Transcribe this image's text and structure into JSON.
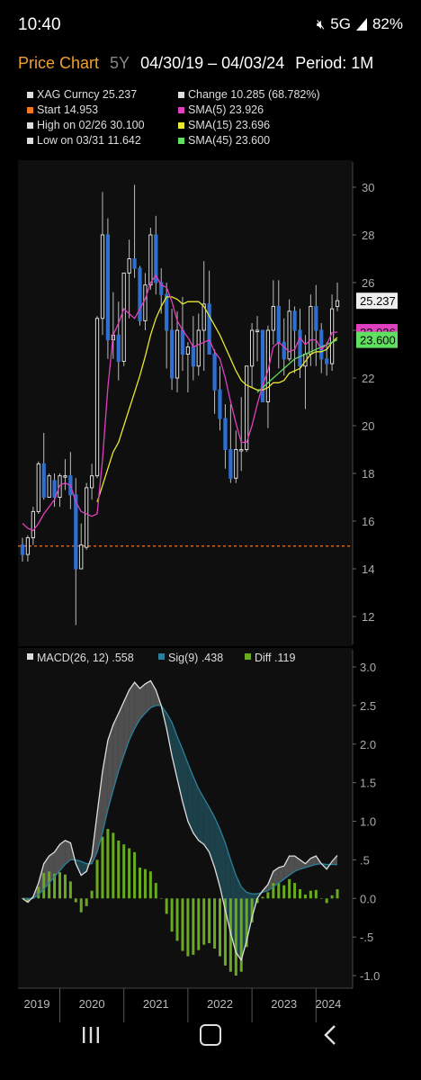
{
  "status_bar": {
    "time": "10:40",
    "network": "5G",
    "battery": "82%"
  },
  "header": {
    "title": "Price Chart",
    "range": "5Y",
    "dates": "04/30/19 – 04/03/24",
    "period": "Period: 1M"
  },
  "legend": [
    {
      "text": "XAG Curncy 25.237",
      "color": "#dddddd"
    },
    {
      "text": "Change 10.285 (68.782%)",
      "color": "#dddddd"
    },
    {
      "text": "Start 14.953",
      "color": "#f07820"
    },
    {
      "text": "SMA(5) 23.926",
      "color": "#e040c0"
    },
    {
      "text": "High on 02/26 30.100",
      "color": "#dddddd"
    },
    {
      "text": "SMA(15) 23.696",
      "color": "#e8e830"
    },
    {
      "text": "Low on 03/31 11.642",
      "color": "#dddddd"
    },
    {
      "text": "SMA(45) 23.600",
      "color": "#60e060"
    }
  ],
  "price_panel": {
    "y_ticks": [
      "30",
      "28",
      "26",
      "24",
      "22",
      "20",
      "18",
      "16",
      "14",
      "12"
    ],
    "last_price_label": "25.237",
    "sma5_label": "23.926",
    "sma45_label": "23.600"
  },
  "macd_panel": {
    "legend": [
      {
        "text": "MACD(26, 12) .558",
        "color": "#dddddd"
      },
      {
        "text": "Sig(9) .438",
        "color": "#2a7f9a"
      },
      {
        "text": "Diff .119",
        "color": "#6aaa20"
      }
    ],
    "y_ticks": [
      "3.0",
      "2.5",
      "2.0",
      "1.5",
      "1.0",
      ".5",
      "0.0",
      "-.5",
      "-1.0"
    ]
  },
  "x_axis": {
    "years": [
      "2019",
      "2020",
      "2021",
      "2022",
      "2023",
      "2024"
    ]
  },
  "colors": {
    "bull": "#dddddd",
    "bear": "#2e6fd0",
    "sma5": "#e040c0",
    "sma15": "#e8e830",
    "sma45": "#60e060",
    "start_line": "#f07820",
    "macd": "#dddddd",
    "signal": "#2a7f9a",
    "diff": "#6aaa20"
  },
  "chart_data": [
    {
      "type": "candlestick",
      "title": "XAG Curncy",
      "y_range": [
        11,
        31
      ],
      "start_value": 14.953,
      "periods": [
        "2019-05",
        "2019-06",
        "2019-07",
        "2019-08",
        "2019-09",
        "2019-10",
        "2019-11",
        "2019-12",
        "2020-01",
        "2020-02",
        "2020-03",
        "2020-04",
        "2020-05",
        "2020-06",
        "2020-07",
        "2020-08",
        "2020-09",
        "2020-10",
        "2020-11",
        "2020-12",
        "2021-01",
        "2021-02",
        "2021-03",
        "2021-04",
        "2021-05",
        "2021-06",
        "2021-07",
        "2021-08",
        "2021-09",
        "2021-10",
        "2021-11",
        "2021-12",
        "2022-01",
        "2022-02",
        "2022-03",
        "2022-04",
        "2022-05",
        "2022-06",
        "2022-07",
        "2022-08",
        "2022-09",
        "2022-10",
        "2022-11",
        "2022-12",
        "2023-01",
        "2023-02",
        "2023-03",
        "2023-04",
        "2023-05",
        "2023-06",
        "2023-07",
        "2023-08",
        "2023-09",
        "2023-10",
        "2023-11",
        "2023-12",
        "2024-01",
        "2024-02",
        "2024-03",
        "2024-04"
      ],
      "open": [
        15.0,
        14.6,
        15.3,
        16.4,
        18.4,
        17.0,
        17.7,
        17.0,
        17.9,
        17.9,
        17.1,
        14.0,
        14.9,
        17.4,
        17.9,
        24.5,
        28.0,
        23.6,
        23.8,
        22.7,
        26.4,
        27.0,
        26.6,
        24.4,
        25.9,
        28.0,
        26.0,
        25.5,
        24.0,
        22.0,
        24.0,
        23.0,
        23.3,
        22.5,
        24.0,
        25.1,
        23.0,
        21.5,
        20.3,
        19.0,
        17.8,
        19.0,
        19.0,
        22.5,
        24.0,
        24.0,
        21.0,
        24.0,
        25.0,
        23.5,
        22.8,
        24.8,
        24.0,
        22.5,
        23.0,
        25.0,
        24.0,
        22.8,
        22.6,
        25.0
      ],
      "high": [
        15.3,
        15.4,
        16.6,
        18.5,
        19.7,
        18.0,
        18.0,
        18.0,
        18.6,
        18.9,
        17.8,
        15.9,
        17.6,
        18.4,
        24.6,
        29.8,
        28.7,
        25.6,
        25.2,
        26.4,
        27.8,
        30.1,
        26.7,
        26.4,
        28.3,
        28.8,
        26.6,
        26.0,
        24.9,
        24.8,
        25.4,
        23.5,
        24.6,
        24.7,
        26.9,
        26.5,
        23.2,
        22.5,
        20.9,
        20.9,
        19.8,
        21.2,
        22.3,
        24.3,
        24.6,
        24.0,
        24.2,
        26.1,
        26.1,
        24.5,
        25.3,
        25.0,
        24.9,
        23.8,
        25.5,
        25.9,
        24.3,
        23.5,
        25.5,
        26.0
      ],
      "low": [
        14.3,
        14.3,
        15.0,
        16.3,
        16.9,
        17.0,
        16.6,
        16.6,
        17.3,
        16.5,
        11.64,
        14.0,
        14.8,
        16.9,
        17.8,
        23.8,
        22.8,
        22.8,
        21.9,
        22.5,
        24.5,
        26.2,
        24.2,
        24.0,
        25.7,
        25.5,
        24.7,
        22.4,
        21.5,
        21.4,
        22.3,
        21.4,
        21.9,
        22.1,
        22.3,
        23.0,
        20.5,
        19.8,
        18.2,
        17.6,
        17.6,
        18.1,
        18.9,
        21.6,
        22.7,
        21.3,
        19.9,
        23.4,
        22.4,
        22.1,
        22.7,
        22.2,
        22.0,
        20.7,
        22.5,
        22.5,
        22.2,
        22.1,
        22.3,
        24.8
      ],
      "close": [
        14.6,
        15.3,
        16.4,
        18.4,
        17.0,
        17.9,
        17.0,
        17.9,
        17.9,
        17.1,
        14.0,
        15.0,
        17.4,
        17.9,
        24.5,
        28.0,
        23.6,
        23.8,
        22.7,
        26.4,
        27.0,
        26.6,
        24.4,
        25.9,
        28.0,
        26.0,
        25.5,
        24.0,
        22.0,
        24.0,
        23.0,
        23.3,
        22.5,
        24.0,
        25.1,
        23.0,
        21.5,
        20.3,
        19.0,
        17.8,
        19.0,
        19.0,
        22.5,
        24.0,
        24.0,
        21.0,
        24.0,
        25.0,
        23.5,
        22.8,
        24.8,
        24.0,
        22.5,
        23.0,
        25.0,
        24.0,
        22.8,
        22.6,
        24.9,
        25.24
      ],
      "sma5": [
        15.9,
        15.7,
        15.6,
        15.9,
        16.3,
        16.6,
        16.9,
        17.5,
        17.6,
        17.5,
        16.8,
        16.4,
        16.3,
        16.2,
        16.3,
        18.6,
        21.6,
        23.8,
        24.3,
        24.9,
        24.7,
        24.5,
        24.9,
        25.3,
        26.0,
        26.3,
        25.9,
        25.8,
        25.2,
        24.4,
        24.0,
        23.7,
        23.3,
        23.4,
        23.5,
        23.6,
        23.1,
        22.8,
        22.0,
        21.0,
        20.1,
        19.3,
        19.3,
        20.0,
        20.9,
        21.7,
        22.3,
        23.3,
        23.5,
        23.3,
        23.1,
        23.2,
        23.7,
        23.4,
        23.6,
        23.6,
        23.2,
        23.4,
        23.9,
        23.93
      ],
      "sma15": [
        null,
        null,
        null,
        null,
        null,
        null,
        null,
        null,
        null,
        null,
        null,
        null,
        null,
        null,
        16.8,
        17.5,
        18.2,
        18.9,
        19.3,
        20.0,
        20.7,
        21.4,
        22.1,
        22.9,
        23.8,
        24.5,
        25.0,
        25.4,
        25.4,
        25.3,
        25.1,
        25.2,
        25.2,
        25.2,
        25.0,
        24.6,
        24.2,
        23.8,
        23.3,
        22.8,
        22.3,
        21.9,
        21.7,
        21.6,
        21.5,
        21.5,
        21.6,
        21.8,
        21.8,
        21.9,
        22.2,
        22.3,
        22.4,
        22.7,
        23.0,
        23.1,
        23.1,
        23.2,
        23.5,
        23.7
      ],
      "sma45": [
        null,
        null,
        null,
        null,
        null,
        null,
        null,
        null,
        null,
        null,
        null,
        null,
        null,
        null,
        null,
        null,
        null,
        null,
        null,
        null,
        null,
        null,
        null,
        null,
        null,
        null,
        null,
        null,
        null,
        null,
        null,
        null,
        null,
        null,
        null,
        null,
        null,
        null,
        null,
        null,
        null,
        null,
        null,
        null,
        21.4,
        21.6,
        21.8,
        22.0,
        22.2,
        22.4,
        22.6,
        22.8,
        22.9,
        23.0,
        23.1,
        23.2,
        23.3,
        23.4,
        23.5,
        23.6
      ]
    },
    {
      "type": "macd",
      "y_range": [
        -1.0,
        3.0
      ],
      "periods_ref": "same as price",
      "macd": [
        0.0,
        -0.05,
        0.02,
        0.2,
        0.45,
        0.55,
        0.6,
        0.7,
        0.75,
        0.72,
        0.45,
        0.3,
        0.35,
        0.55,
        1.1,
        1.65,
        2.05,
        2.25,
        2.4,
        2.55,
        2.7,
        2.8,
        2.72,
        2.78,
        2.82,
        2.7,
        2.5,
        2.2,
        1.85,
        1.55,
        1.25,
        1.0,
        0.85,
        0.75,
        0.7,
        0.6,
        0.4,
        0.15,
        -0.15,
        -0.45,
        -0.7,
        -0.8,
        -0.55,
        -0.25,
        0.0,
        0.1,
        0.18,
        0.35,
        0.4,
        0.42,
        0.55,
        0.55,
        0.5,
        0.45,
        0.52,
        0.55,
        0.45,
        0.38,
        0.48,
        0.558
      ],
      "signal": [
        0.0,
        0.0,
        0.0,
        0.05,
        0.12,
        0.2,
        0.28,
        0.36,
        0.44,
        0.5,
        0.5,
        0.48,
        0.45,
        0.45,
        0.6,
        0.85,
        1.15,
        1.4,
        1.65,
        1.85,
        2.05,
        2.2,
        2.32,
        2.4,
        2.47,
        2.5,
        2.5,
        2.4,
        2.28,
        2.1,
        1.93,
        1.75,
        1.58,
        1.42,
        1.3,
        1.18,
        1.05,
        0.9,
        0.72,
        0.5,
        0.3,
        0.15,
        0.08,
        0.06,
        0.06,
        0.08,
        0.1,
        0.15,
        0.2,
        0.25,
        0.3,
        0.35,
        0.38,
        0.4,
        0.42,
        0.44,
        0.45,
        0.44,
        0.44,
        0.438
      ],
      "diff": [
        0.0,
        -0.05,
        0.02,
        0.15,
        0.33,
        0.35,
        0.32,
        0.34,
        0.31,
        0.22,
        -0.05,
        -0.18,
        -0.1,
        0.1,
        0.5,
        0.8,
        0.9,
        0.85,
        0.75,
        0.7,
        0.65,
        0.6,
        0.4,
        0.38,
        0.35,
        0.2,
        0.0,
        -0.2,
        -0.43,
        -0.55,
        -0.68,
        -0.75,
        -0.73,
        -0.67,
        -0.6,
        -0.58,
        -0.65,
        -0.75,
        -0.87,
        -0.95,
        -1.0,
        -0.95,
        -0.63,
        -0.31,
        -0.06,
        0.02,
        0.08,
        0.2,
        0.2,
        0.17,
        0.25,
        0.2,
        0.12,
        0.05,
        0.1,
        0.11,
        0.0,
        -0.06,
        0.04,
        0.119
      ]
    }
  ]
}
